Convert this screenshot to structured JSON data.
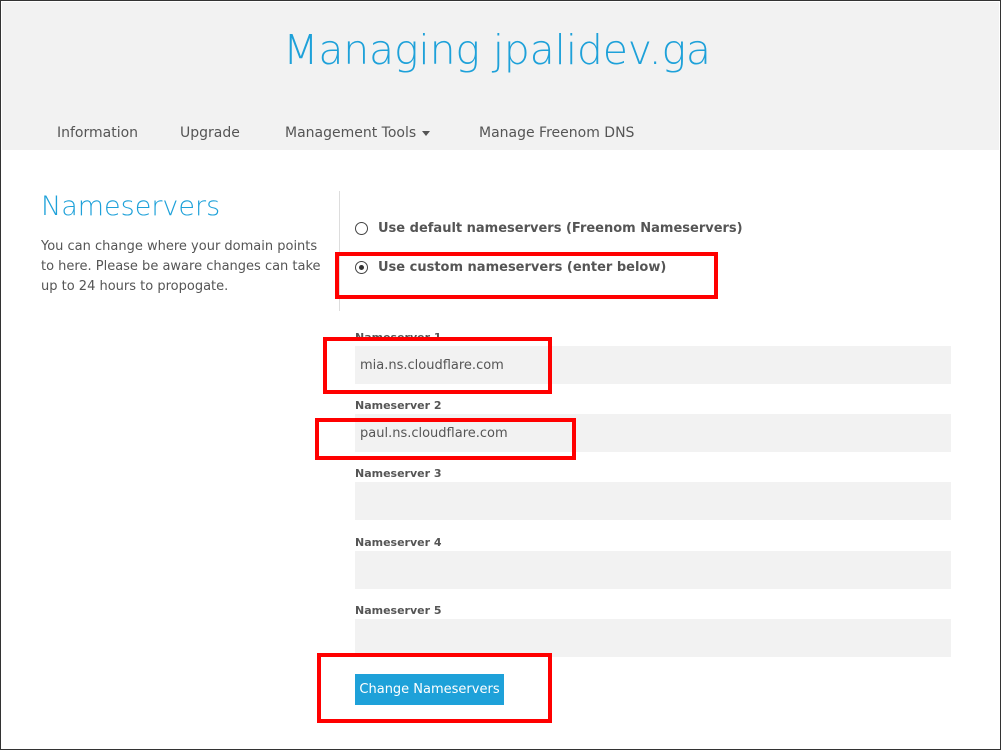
{
  "header": {
    "title": "Managing jpalidev.ga",
    "nav": [
      {
        "label": "Information"
      },
      {
        "label": "Upgrade"
      },
      {
        "label": "Management Tools"
      },
      {
        "label": "Manage Freenom DNS"
      }
    ]
  },
  "section": {
    "title": "Nameservers",
    "description": "You can change where your domain points to here. Please be aware changes can take up to 24 hours to propogate."
  },
  "options": {
    "default_label": "Use default nameservers (Freenom Nameservers)",
    "custom_label": "Use custom nameservers (enter below)",
    "selected": "custom"
  },
  "nameservers": [
    {
      "label": "Nameserver 1",
      "value": "mia.ns.cloudflare.com"
    },
    {
      "label": "Nameserver 2",
      "value": "paul.ns.cloudflare.com"
    },
    {
      "label": "Nameserver 3",
      "value": ""
    },
    {
      "label": "Nameserver 4",
      "value": ""
    },
    {
      "label": "Nameserver 5",
      "value": ""
    }
  ],
  "submit_label": "Change Nameservers",
  "colors": {
    "accent": "#1ea1d9",
    "annotation": "#ff0000",
    "header_bg": "#f2f2f2"
  }
}
